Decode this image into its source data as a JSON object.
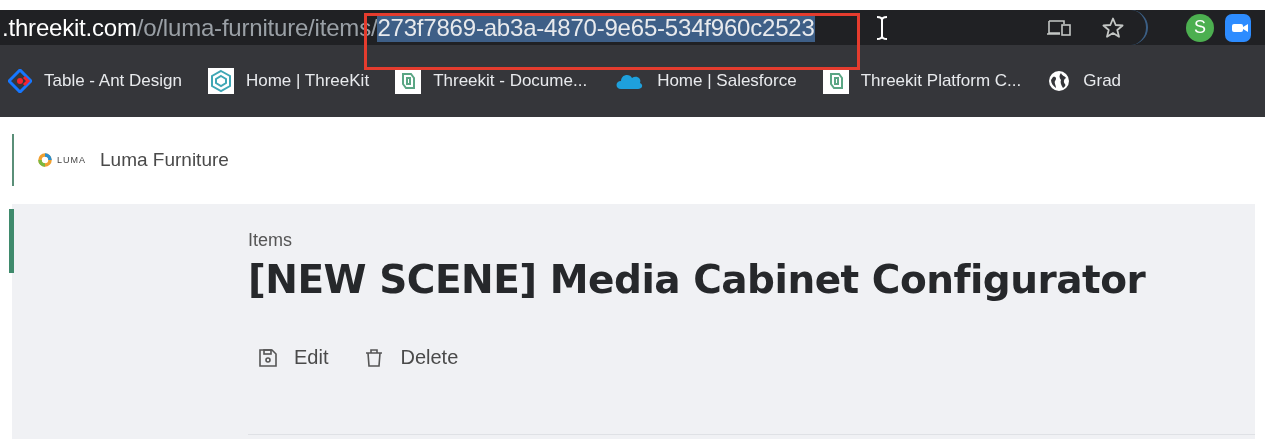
{
  "address_bar": {
    "host": ".threekit.com",
    "path": "/o/luma-furniture/items/",
    "selected_text": "273f7869-ab3a-4870-9e65-534f960c2523"
  },
  "profile_avatar": {
    "initial": "S"
  },
  "bookmarks": [
    {
      "kind": "ant",
      "label": "Table - Ant Design"
    },
    {
      "kind": "threekit",
      "label": "Home | ThreeKit"
    },
    {
      "kind": "docs",
      "label": "Threekit - Docume..."
    },
    {
      "kind": "cloud",
      "label": "Home | Salesforce"
    },
    {
      "kind": "docs",
      "label": "Threekit Platform C..."
    },
    {
      "kind": "globe",
      "label": "Grad"
    }
  ],
  "org": {
    "logo_text": "LUMA",
    "name": "Luma Furniture"
  },
  "breadcrumb": "Items",
  "title": "[NEW SCENE] Media Cabinet Configurator",
  "actions": [
    {
      "kind": "edit",
      "label": "Edit"
    },
    {
      "kind": "delete",
      "label": "Delete"
    }
  ]
}
